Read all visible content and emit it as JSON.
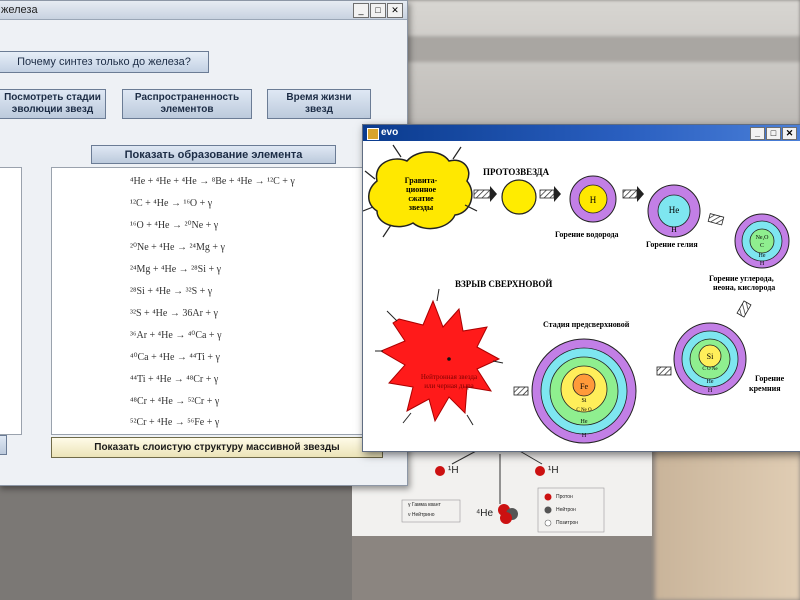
{
  "main_window": {
    "title": "железа",
    "controls": [
      "_",
      "□",
      "✕"
    ],
    "buttons": {
      "why_iron": "Почему синтез только до железа?",
      "stages": [
        "Посмотреть стадии",
        "эволюции звезд"
      ],
      "abundance": [
        "Распространенность",
        "элементов"
      ],
      "lifetime": [
        "Время жизни",
        "звезд"
      ],
      "show_formation": "Показать образование элемента",
      "show_layers": "Показать слоистую структуру массивной звезды"
    },
    "reactions": [
      "⁴He + ⁴He + ⁴He → ⁸Be + ⁴He → ¹²C + γ",
      "¹²C + ⁴He → ¹⁶O + γ",
      "¹⁶O + ⁴He → ²⁰Ne + γ",
      "²⁰Ne + ⁴He → ²⁴Mg + γ",
      "²⁴Mg + ⁴He → ²⁸Si + γ",
      "²⁸Si + ⁴He → ³²S + γ",
      "³²S + ⁴He → 36Ar + γ",
      "³⁶Ar + ⁴He → ⁴⁰Ca + γ",
      "⁴⁰Ca + ⁴He → ⁴⁴Ti + γ",
      "⁴⁴Ti + ⁴He → ⁴⁸Cr + γ",
      "⁴⁸Cr + ⁴He → ⁵²Cr + γ",
      "⁵²Cr + ⁴He → ⁵⁶Fe + γ"
    ]
  },
  "evo_window": {
    "title": "evo",
    "controls": [
      "_",
      "□",
      "✕"
    ],
    "labels": {
      "cloud": [
        "Гравита-",
        "ционное",
        "сжатие",
        "звезды"
      ],
      "protostar": "ПРОТОЗВЕЗДА",
      "h_burning": "Горение водорода",
      "he_burning": "Горение гелия",
      "cno_burning": [
        "Горение углерода,",
        "неона, кислорода"
      ],
      "supernova": "ВЗРЫВ СВЕРХНОВОЙ",
      "pre_supernova": "Стадия предсверхновой",
      "si_burning": [
        "Горение",
        "кремния"
      ],
      "neutron_star": [
        "Нейтронная звезда",
        "или черная дыра"
      ]
    },
    "shell_labels": {
      "star_h": "H",
      "star_he_core": "He",
      "star_he_shell": "H",
      "star_cno_core": "Ne,O",
      "star_cno_c": "C",
      "star_cno_he": "He",
      "star_cno_h": "H",
      "star_si_core": "Si",
      "star_si_shell": "C O Ne",
      "star_si_he": "He",
      "star_si_h": "H",
      "star_fe_core": "Fe",
      "star_fe_si": "Si",
      "star_fe_cone": "C Ne O",
      "star_fe_he": "He",
      "star_fe_h": "H"
    },
    "colors": {
      "cloud": "#ffe800",
      "protostar": "#ffec00",
      "shell_purple": "#c27fe6",
      "shell_cyan": "#7ee6f0",
      "shell_green": "#8fef8f",
      "shell_yellow": "#ffee5a",
      "core_orange": "#ff9a3a",
      "supernova": "#ff1a1a"
    }
  },
  "background_doc": {
    "isotopes": [
      "¹H",
      "¹H",
      "⁴He"
    ],
    "legend_left": [
      "γ Гамма квант",
      "ν Нейтрино"
    ],
    "legend_right": [
      "Протон",
      "Нейтрон",
      "Позитрон"
    ]
  }
}
